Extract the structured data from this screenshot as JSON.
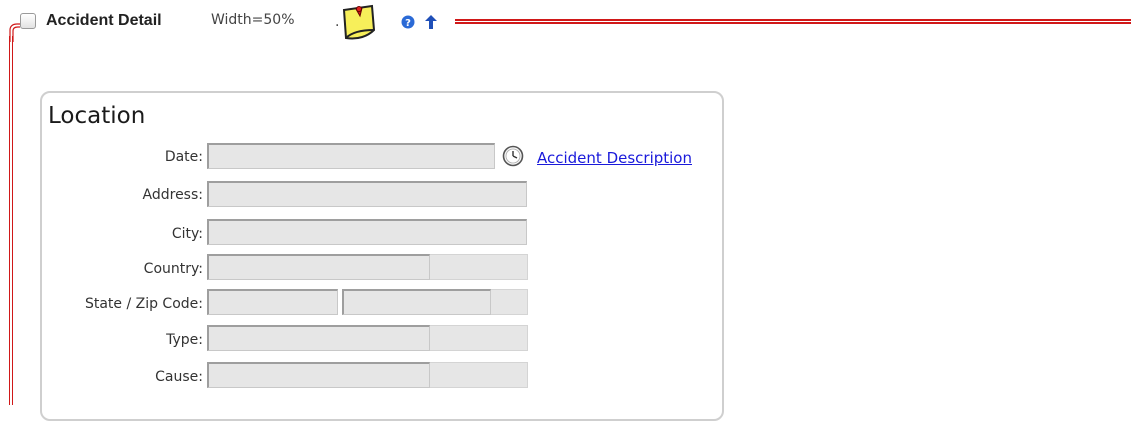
{
  "header": {
    "title": "Accident Detail",
    "width_label": "Width=50%",
    "dot": "."
  },
  "icons": {
    "note": "sticky-note-icon",
    "help": "help-icon",
    "up": "arrow-up-icon",
    "clock": "clock-icon"
  },
  "colors": {
    "frame_red": "#d01818",
    "link_blue": "#1a1adb",
    "field_gray": "#e6e6e6"
  },
  "location": {
    "title": "Location",
    "date_label": "Date:",
    "date_value": "",
    "link": "Accident Description",
    "address_label": "Address:",
    "address_value": "",
    "city_label": "City:",
    "city_value": "",
    "country_label": "Country:",
    "country_value": "",
    "state_zip_label": "State / Zip Code:",
    "state_value": "",
    "zip_value": "",
    "type_label": "Type:",
    "type_value": "",
    "cause_label": "Cause:",
    "cause_value": ""
  }
}
